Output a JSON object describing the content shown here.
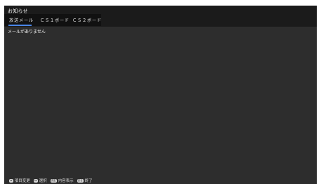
{
  "screen": {
    "title": "お知らせ",
    "tabs": [
      {
        "label": "放送メール",
        "active": true
      },
      {
        "label": "ＣＳ１ボード",
        "active": false
      },
      {
        "label": "ＣＳ２ボード",
        "active": false
      }
    ],
    "message": "メールがありません",
    "footer": [
      {
        "key": "◂▸",
        "label": "項目変更",
        "icon": "left-right-arrows-icon"
      },
      {
        "key": "▴▾",
        "label": "選択",
        "icon": "up-down-arrows-icon"
      },
      {
        "key": "決定",
        "label": "内容表示",
        "icon": "enter-key-icon"
      },
      {
        "key": "戻る",
        "label": "終了",
        "icon": "back-key-icon"
      }
    ]
  },
  "colors": {
    "background": "#2d2d2d",
    "header": "#1b1b1b",
    "tab_bar": "#111111",
    "accent": "#4a86e8"
  }
}
